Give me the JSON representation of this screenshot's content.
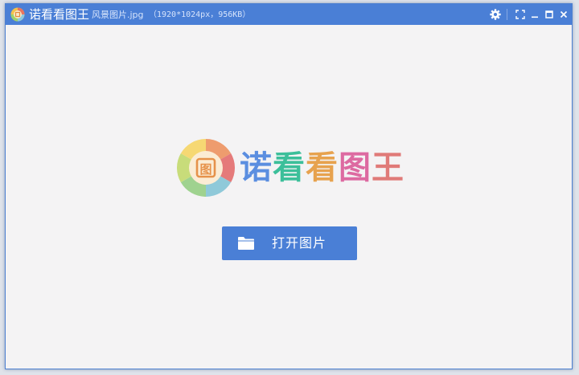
{
  "titlebar": {
    "app_name": "诺看看图王",
    "file_name": "风景图片.jpg",
    "file_info": "（1920*1024px，956KB）",
    "icons": {
      "app": "app-logo-icon",
      "settings": "gear-icon",
      "fullscreen": "fullscreen-icon",
      "minimize": "minimize-icon",
      "maximize": "maximize-icon",
      "close": "close-icon"
    }
  },
  "logo": {
    "chars": [
      "诺",
      "看",
      "看",
      "图",
      "王"
    ],
    "char_colors": [
      "#5b8ee0",
      "#3cbf9a",
      "#e7a24e",
      "#dd6aa1",
      "#e07a78"
    ],
    "mark_char": "图"
  },
  "main": {
    "open_button_label": "打开图片",
    "open_button_icon": "folder-icon"
  },
  "colors": {
    "accent": "#4a7fd6",
    "background": "#f4f3f4"
  }
}
